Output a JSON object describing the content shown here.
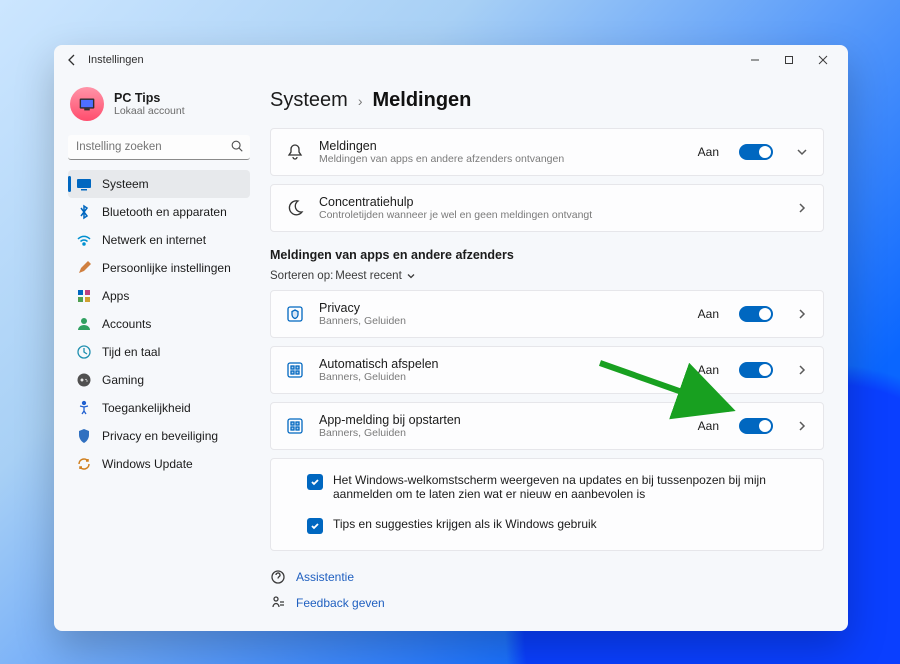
{
  "window": {
    "app_title": "Instellingen"
  },
  "account": {
    "name": "PC Tips",
    "sub": "Lokaal account"
  },
  "search": {
    "placeholder": "Instelling zoeken"
  },
  "nav": {
    "items": [
      {
        "label": "Systeem"
      },
      {
        "label": "Bluetooth en apparaten"
      },
      {
        "label": "Netwerk en internet"
      },
      {
        "label": "Persoonlijke instellingen"
      },
      {
        "label": "Apps"
      },
      {
        "label": "Accounts"
      },
      {
        "label": "Tijd en taal"
      },
      {
        "label": "Gaming"
      },
      {
        "label": "Toegankelijkheid"
      },
      {
        "label": "Privacy en beveiliging"
      },
      {
        "label": "Windows Update"
      }
    ]
  },
  "crumbs": {
    "parent": "Systeem",
    "current": "Meldingen"
  },
  "cards": {
    "notifications": {
      "title": "Meldingen",
      "desc": "Meldingen van apps en andere afzenders ontvangen",
      "state": "Aan"
    },
    "focus": {
      "title": "Concentratiehulp",
      "desc": "Controletijden wanneer je wel en geen meldingen ontvangt"
    }
  },
  "section": {
    "heading": "Meldingen van apps en andere afzenders"
  },
  "sort": {
    "label": "Sorteren op:",
    "value": "Meest recent"
  },
  "apps": [
    {
      "title": "Privacy",
      "desc": "Banners, Geluiden",
      "state": "Aan"
    },
    {
      "title": "Automatisch afspelen",
      "desc": "Banners, Geluiden",
      "state": "Aan"
    },
    {
      "title": "App-melding bij opstarten",
      "desc": "Banners, Geluiden",
      "state": "Aan"
    }
  ],
  "checks": [
    {
      "text": "Het Windows-welkomstscherm weergeven na updates en bij tussenpozen bij mijn aanmelden om te laten zien wat er nieuw en aanbevolen is"
    },
    {
      "text": "Tips en suggesties krijgen als ik Windows gebruik"
    }
  ],
  "footer": {
    "help": "Assistentie",
    "feedback": "Feedback geven"
  }
}
